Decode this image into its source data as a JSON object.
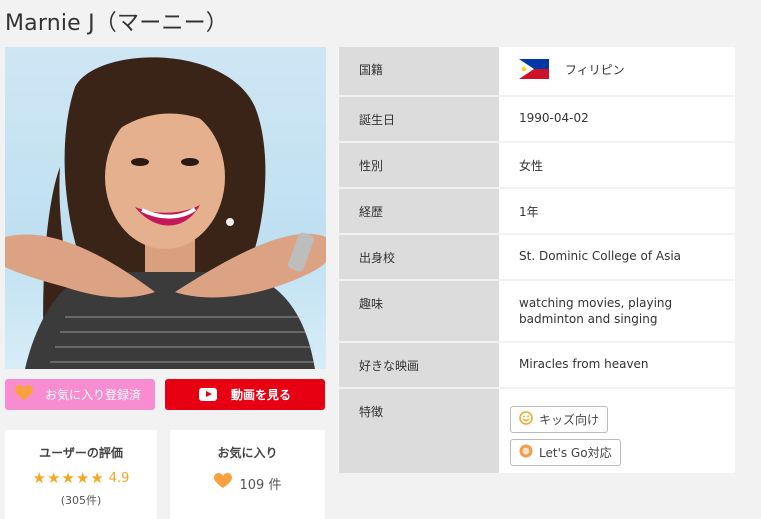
{
  "page": {
    "title": "Marnie J（マーニー）"
  },
  "actions": {
    "favorite_label": "お気に入り登録済",
    "video_label": "動画を見る"
  },
  "rating": {
    "title": "ユーザーの評価",
    "score": "4.9",
    "stars": 4.9,
    "reviews": "(305件)"
  },
  "favorites": {
    "title": "お気に入り",
    "count": "109 件"
  },
  "profile": {
    "rows": [
      {
        "key": "国籍",
        "value": "フィリピン"
      },
      {
        "key": "誕生日",
        "value": "1990-04-02"
      },
      {
        "key": "性別",
        "value": "女性"
      },
      {
        "key": "経歴",
        "value": "1年"
      },
      {
        "key": "出身校",
        "value": "St. Dominic College of Asia"
      },
      {
        "key": "趣味",
        "value": "watching movies, playing badminton and singing"
      },
      {
        "key": "好きな映画",
        "value": "Miracles from heaven"
      },
      {
        "key": "特徴",
        "tags": [
          "キッズ向け",
          "Let's Go対応"
        ]
      }
    ]
  },
  "colors": {
    "favorite_button": "#f78dd0",
    "video_button": "#e60012",
    "star": "#f5a623",
    "key_cell": "#dcdcdc"
  }
}
